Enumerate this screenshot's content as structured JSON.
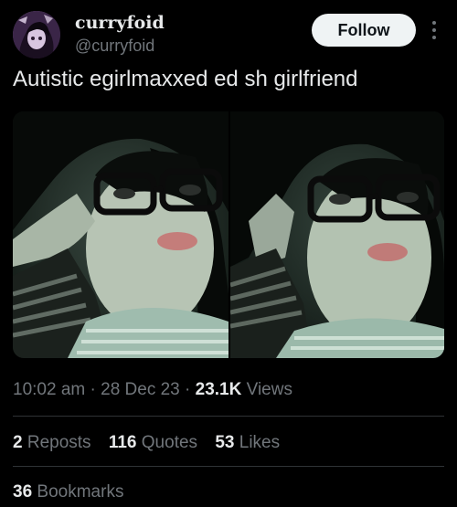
{
  "author": {
    "display_name": "curryfoid",
    "handle": "@curryfoid",
    "avatar_icon": "profile-avatar"
  },
  "follow_label": "Follow",
  "more_icon": "more-vertical-icon",
  "post": {
    "text": "Autistic egirlmaxxed ed sh girlfriend"
  },
  "media": {
    "count": 2,
    "style": "dark green-tinted selfie photos"
  },
  "meta": {
    "time": "10:02 am",
    "sep1": " · ",
    "date": "28 Dec 23",
    "sep2": " · ",
    "views_count": "23.1K",
    "views_label": " Views"
  },
  "stats": {
    "reposts_count": "2",
    "reposts_label": "Reposts",
    "quotes_count": "116",
    "quotes_label": "Quotes",
    "likes_count": "53",
    "likes_label": "Likes",
    "bookmarks_count": "36",
    "bookmarks_label": "Bookmarks"
  },
  "colors": {
    "background": "#000000",
    "text": "#e7e9ea",
    "muted": "#71767b",
    "divider": "#2f3336",
    "follow_bg": "#eff3f4"
  }
}
